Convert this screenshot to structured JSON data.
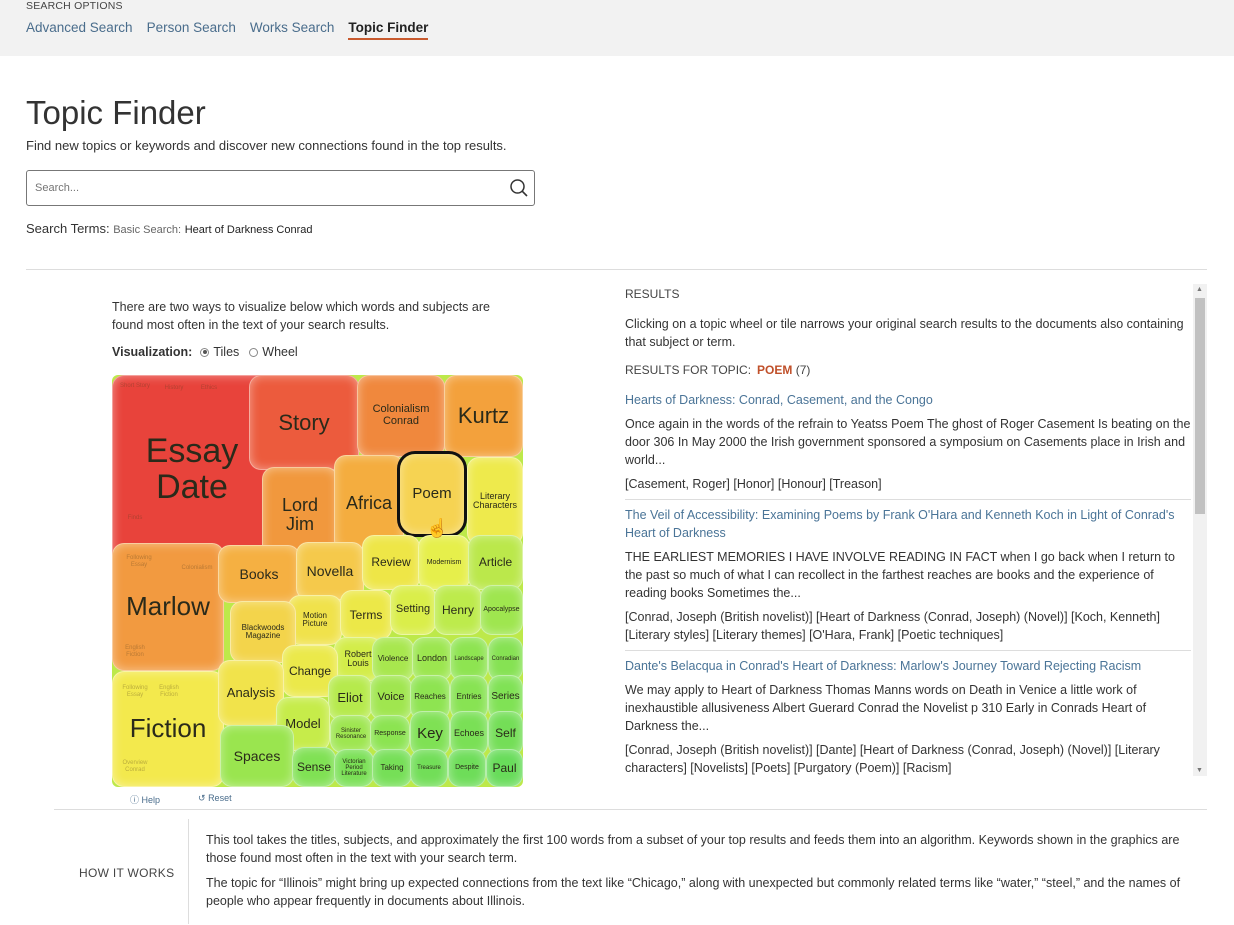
{
  "header": {
    "section_label": "SEARCH OPTIONS",
    "tabs": [
      {
        "label": "Advanced Search"
      },
      {
        "label": "Person Search"
      },
      {
        "label": "Works Search"
      },
      {
        "label": "Topic Finder",
        "active": true
      }
    ]
  },
  "page": {
    "title": "Topic Finder",
    "subtitle": "Find new topics or keywords and discover new connections found in the top results.",
    "search_placeholder": "Search...",
    "search_terms_label": "Search Terms:",
    "search_terms_type": "Basic Search:",
    "search_terms_query": "Heart of Darkness Conrad"
  },
  "visualization": {
    "intro": "There are two ways to visualize below which words and subjects are found most often in the text of your search results.",
    "label": "Visualization:",
    "options": [
      {
        "label": "Tiles",
        "selected": true
      },
      {
        "label": "Wheel",
        "selected": false
      }
    ],
    "selected_topic": "Poem",
    "help_label": "Help",
    "reset_label": "Reset",
    "tiles": [
      {
        "label": "Essay Date",
        "color": "#e8433b"
      },
      {
        "label": "Story",
        "color": "#ec5b3d"
      },
      {
        "label": "Colonialism Conrad",
        "color": "#f0883d"
      },
      {
        "label": "Kurtz",
        "color": "#f3a13c"
      },
      {
        "label": "Lord Jim",
        "color": "#f1983d"
      },
      {
        "label": "Africa",
        "color": "#f4ad3f"
      },
      {
        "label": "Poem",
        "color": "#f6d352"
      },
      {
        "label": "Literary Characters",
        "color": "#eeea4c"
      },
      {
        "label": "Marlow",
        "color": "#f29a40"
      },
      {
        "label": "Books",
        "color": "#f5b042"
      },
      {
        "label": "Novella",
        "color": "#f5c94b"
      },
      {
        "label": "Review",
        "color": "#eee647"
      },
      {
        "label": "Modernism",
        "color": "#e6ef4b"
      },
      {
        "label": "Article",
        "color": "#bbe84b"
      },
      {
        "label": "Motion Picture",
        "color": "#f0e24b"
      },
      {
        "label": "Blackwoods Magazine",
        "color": "#f3d44b"
      },
      {
        "label": "Terms",
        "color": "#ece848"
      },
      {
        "label": "Setting",
        "color": "#daee4a"
      },
      {
        "label": "Henry",
        "color": "#bdeb4c"
      },
      {
        "label": "Apocalypse",
        "color": "#9fe64f"
      },
      {
        "label": "Robert Louis",
        "color": "#d3ed49"
      },
      {
        "label": "Change",
        "color": "#ebe94a"
      },
      {
        "label": "Violence",
        "color": "#a8e74e"
      },
      {
        "label": "London",
        "color": "#9ce64f"
      },
      {
        "label": "Landscape",
        "color": "#8ee451"
      },
      {
        "label": "Conradian",
        "color": "#86e253"
      },
      {
        "label": "Fiction",
        "color": "#f3e94d"
      },
      {
        "label": "Analysis",
        "color": "#f1e34b"
      },
      {
        "label": "Eliot",
        "color": "#b6ea4c"
      },
      {
        "label": "Voice",
        "color": "#a0e64f"
      },
      {
        "label": "Reaches",
        "color": "#8ee451"
      },
      {
        "label": "Entries",
        "color": "#88e353"
      },
      {
        "label": "Series",
        "color": "#80e255"
      },
      {
        "label": "Model",
        "color": "#c6ec4a"
      },
      {
        "label": "Sinister Resonance",
        "color": "#9ee650"
      },
      {
        "label": "Response",
        "color": "#8ce451"
      },
      {
        "label": "Key",
        "color": "#7fe154"
      },
      {
        "label": "Echoes",
        "color": "#7ae056"
      },
      {
        "label": "Self",
        "color": "#74de57"
      },
      {
        "label": "Spaces",
        "color": "#9ae54f"
      },
      {
        "label": "Sense",
        "color": "#80e154"
      },
      {
        "label": "Victorian Period Literature",
        "color": "#7ae056"
      },
      {
        "label": "Taking",
        "color": "#76df57"
      },
      {
        "label": "Treasure",
        "color": "#72de58"
      },
      {
        "label": "Despite",
        "color": "#6edd59"
      },
      {
        "label": "Paul",
        "color": "#68dc5a"
      }
    ],
    "faint_labels": [
      "Short Story",
      "History",
      "Ethics",
      "Finds",
      "Following Essay",
      "Colonialism",
      "English Fiction",
      "Following Essay",
      "English Fiction",
      "Overview Conrad"
    ]
  },
  "results": {
    "heading": "RESULTS",
    "description": "Clicking on a topic wheel or tile narrows your original search results to the documents also containing that subject or term.",
    "topic_label": "RESULTS FOR TOPIC:",
    "topic": "POEM",
    "count": "(7)",
    "items": [
      {
        "title": "Hearts of Darkness: Conrad, Casement, and the Congo",
        "snippet": "Once again in the words of the refrain to Yeatss Poem The ghost of Roger Casement Is beating on the door 306 In May 2000 the Irish government sponsored a symposium on Casements place in Irish and world...",
        "subjects": "[Casement, Roger] [Honor] [Honour] [Treason]"
      },
      {
        "title": "The Veil of Accessibility: Examining Poems by Frank O'Hara and Kenneth Koch in Light of Conrad's Heart of Darkness",
        "snippet": "THE EARLIEST MEMORIES I HAVE INVOLVE READING IN FACT when I go back when I return to the past so much of what I can recollect in the farthest reaches are books and the experience of reading books Sometimes the...",
        "subjects": "[Conrad, Joseph (British novelist)] [Heart of Darkness (Conrad, Joseph) (Novel)] [Koch, Kenneth] [Literary styles] [Literary themes] [O'Hara, Frank] [Poetic techniques]"
      },
      {
        "title": "Dante's Belacqua in Conrad's Heart of Darkness: Marlow's Journey Toward Rejecting Racism",
        "snippet": "We may apply to Heart of Darkness Thomas Manns words on Death in Venice a little work of inexhaustible allusiveness Albert Guerard Conrad the Novelist p 310 Early in Conrads Heart of Darkness the...",
        "subjects": "[Conrad, Joseph (British novelist)] [Dante] [Heart of Darkness (Conrad, Joseph) (Novel)] [Literary characters] [Novelists] [Poets] [Purgatory (Poem)] [Racism]"
      }
    ]
  },
  "how_it_works": {
    "label": "HOW IT WORKS",
    "paragraphs": [
      "This tool takes the titles, subjects, and approximately the first 100 words from a subset of your top results and feeds them into an algorithm. Keywords shown in the graphics are those found most often in the text with your search term.",
      "The topic for “Illinois” might bring up expected connections from the text like “Chicago,” along with unexpected but commonly related terms like “water,” “steel,” and the names of people who appear frequently in documents about Illinois."
    ]
  }
}
